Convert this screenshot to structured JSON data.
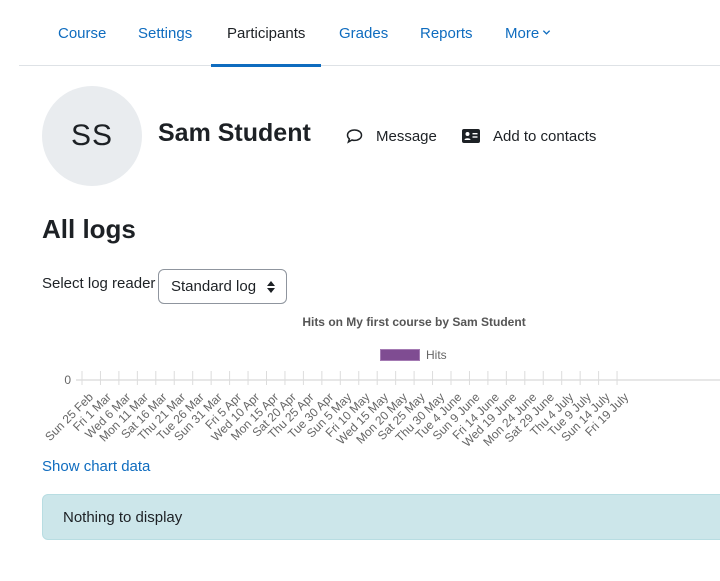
{
  "nav": {
    "tabs": [
      {
        "label": "Course"
      },
      {
        "label": "Settings"
      },
      {
        "label": "Participants",
        "active": true
      },
      {
        "label": "Grades"
      },
      {
        "label": "Reports"
      },
      {
        "label": "More"
      }
    ]
  },
  "user": {
    "initials": "SS",
    "name": "Sam Student",
    "message_label": "Message",
    "add_contact_label": "Add to contacts"
  },
  "heading": "All logs",
  "reader": {
    "label": "Select log reader",
    "selected": "Standard log"
  },
  "chart_data": {
    "type": "bar",
    "title": "Hits on My first course by Sam Student",
    "legend_position": "top",
    "series": [
      {
        "name": "Hits",
        "color": "#7f4c92",
        "values": [
          0,
          0,
          0,
          0,
          0,
          0,
          0,
          0,
          0,
          0,
          0,
          0,
          0,
          0,
          0,
          0,
          0,
          0,
          0,
          0,
          0,
          0,
          0,
          0,
          0,
          0,
          0,
          0
        ]
      }
    ],
    "categories": [
      "Sun 25 Feb",
      "Fri 1 Mar",
      "Wed 6 Mar",
      "Mon 11 Mar",
      "Sat 16 Mar",
      "Thu 21 Mar",
      "Tue 26 Mar",
      "Sun 31 Mar",
      "Fri 5 Apr",
      "Wed 10 Apr",
      "Mon 15 Apr",
      "Sat 20 Apr",
      "Thu 25 Apr",
      "Tue 30 Apr",
      "Sun 5 May",
      "Fri 10 May",
      "Wed 15 May",
      "Mon 20 May",
      "Sat 25 May",
      "Thu 30 May",
      "Tue 4 June",
      "Sun 9 June",
      "Fri 14 June",
      "Wed 19 June",
      "Mon 24 June",
      "Sat 29 June",
      "Thu 4 July",
      "Tue 9 July",
      "Sun 14 July",
      "Fri 19 July"
    ],
    "y_ticks": [
      "0"
    ],
    "ylim": [
      0,
      1
    ]
  },
  "chart_link": "Show chart data",
  "notice": "Nothing to display"
}
